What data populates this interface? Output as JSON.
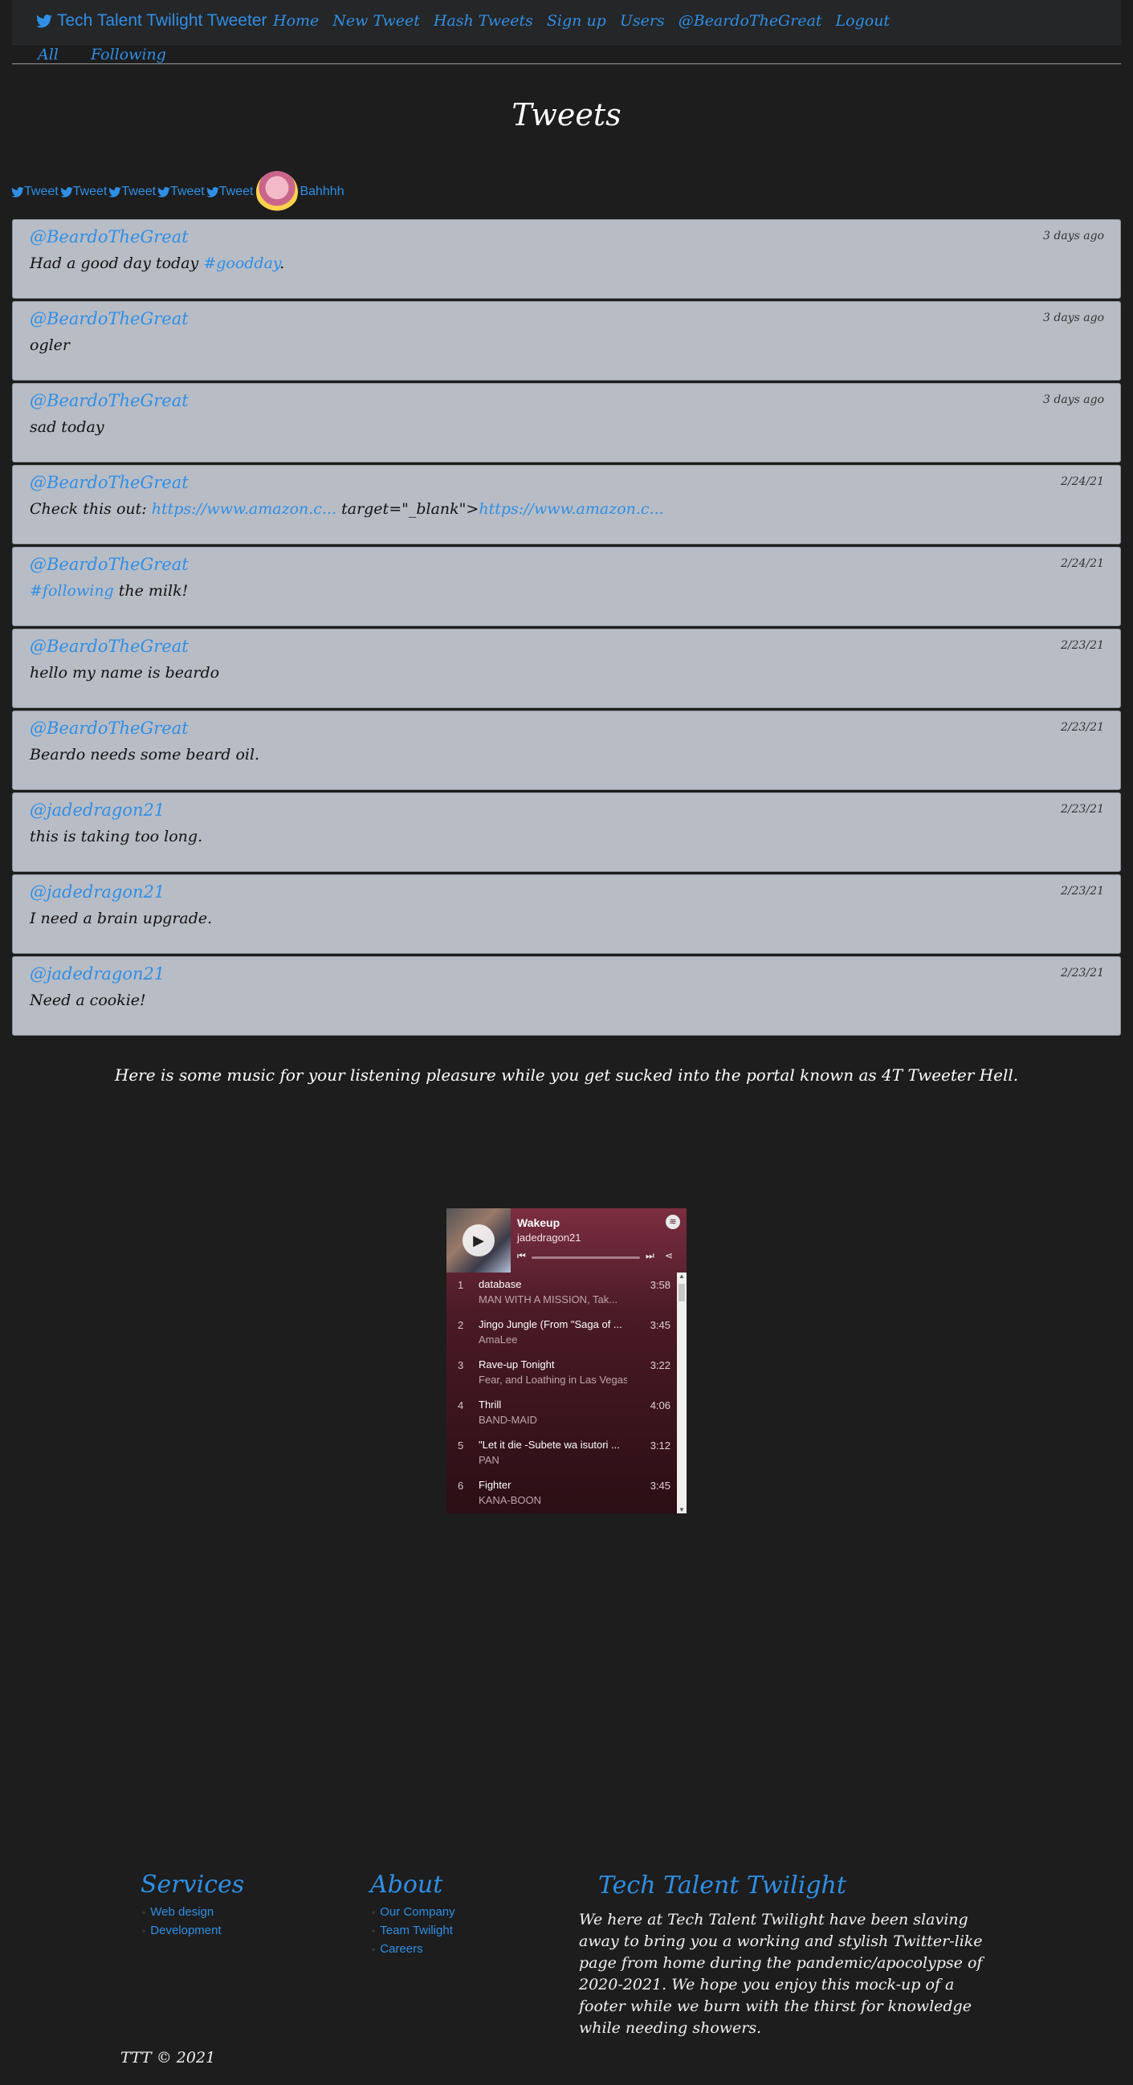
{
  "nav": {
    "brand": "Tech Talent Twilight Tweeter",
    "links": [
      "Home",
      "New Tweet",
      "Hash Tweets",
      "Sign up",
      "Users",
      "@BeardoTheGreat",
      "Logout"
    ]
  },
  "tabs": {
    "all": "All",
    "following": "Following"
  },
  "page_title": "Tweets",
  "tweet_buttons": [
    "Tweet",
    "Tweet",
    "Tweet",
    "Tweet",
    "Tweet"
  ],
  "user_link": "Bahhhh",
  "tweets": [
    {
      "user": "@BeardoTheGreat",
      "time": "3 days ago",
      "pre": "Had a good day today ",
      "tag": "#goodday",
      "post": "."
    },
    {
      "user": "@BeardoTheGreat",
      "time": "3 days ago",
      "pre": "ogler",
      "tag": "",
      "post": ""
    },
    {
      "user": "@BeardoTheGreat",
      "time": "3 days ago",
      "pre": "sad today",
      "tag": "",
      "post": ""
    },
    {
      "user": "@BeardoTheGreat",
      "time": "2/24/21",
      "pre": "Check this out: ",
      "tag": "https://www.amazon.c...",
      "post": " target=\"_blank\">",
      "tag2": "https://www.amazon.c..."
    },
    {
      "user": "@BeardoTheGreat",
      "time": "2/24/21",
      "pre": "",
      "tag": "#following",
      "post": " the milk!"
    },
    {
      "user": "@BeardoTheGreat",
      "time": "2/23/21",
      "pre": "hello my name is beardo",
      "tag": "",
      "post": ""
    },
    {
      "user": "@BeardoTheGreat",
      "time": "2/23/21",
      "pre": "Beardo needs some beard oil.",
      "tag": "",
      "post": ""
    },
    {
      "user": "@jadedragon21",
      "time": "2/23/21",
      "pre": "this is taking too long.",
      "tag": "",
      "post": ""
    },
    {
      "user": "@jadedragon21",
      "time": "2/23/21",
      "pre": "I need a brain upgrade.",
      "tag": "",
      "post": ""
    },
    {
      "user": "@jadedragon21",
      "time": "2/23/21",
      "pre": "Need a cookie!",
      "tag": "",
      "post": ""
    }
  ],
  "music_note": "Here is some music for your listening pleasure while you get sucked into the portal known as 4T Tweeter Hell.",
  "player": {
    "title": "Wakeup",
    "owner": "jadedragon21",
    "tracks": [
      {
        "num": "1",
        "name": "database",
        "artist": "MAN WITH A MISSION, Tak...",
        "dur": "3:58"
      },
      {
        "num": "2",
        "name": "Jingo Jungle (From \"Saga of ...",
        "artist": "AmaLee",
        "dur": "3:45"
      },
      {
        "num": "3",
        "name": "Rave-up Tonight",
        "artist": "Fear, and Loathing in Las Vegas",
        "dur": "3:22"
      },
      {
        "num": "4",
        "name": "Thrill",
        "artist": "BAND-MAID",
        "dur": "4:06"
      },
      {
        "num": "5",
        "name": "\"Let it die -Subete wa isutori ...",
        "artist": "PAN",
        "dur": "3:12"
      },
      {
        "num": "6",
        "name": "Fighter",
        "artist": "KANA-BOON",
        "dur": "3:45"
      }
    ]
  },
  "footer": {
    "services": {
      "title": "Services",
      "items": [
        "Web design",
        "Development"
      ]
    },
    "about": {
      "title": "About",
      "items": [
        "Our Company",
        "Team Twilight",
        "Careers"
      ]
    },
    "company": {
      "title": "Tech Talent Twilight",
      "text": "We here at Tech Talent Twilight have been slaving away to bring you a working and stylish Twitter-like page from home during the pandemic/apocolypse of 2020-2021. We hope you enjoy this mock-up of a footer while we burn with the thirst for knowledge while needing showers."
    },
    "copyright": "TTT © 2021"
  },
  "colors": {
    "accent": "#2f8fe6",
    "background": "#1d1d1d",
    "card": "#b8bcc5"
  },
  "icons": [
    "twitter-bird-icon",
    "play-icon",
    "spotify-icon",
    "skip-back-icon",
    "skip-forward-icon",
    "share-icon"
  ]
}
